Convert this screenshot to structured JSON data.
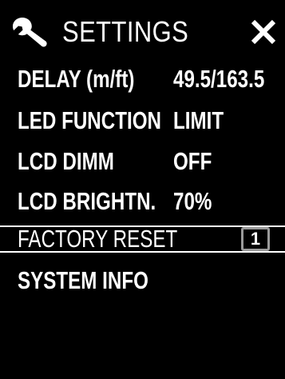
{
  "header": {
    "title": "SETTINGS",
    "left_icon": "wrench-icon",
    "right_icon": "close-icon"
  },
  "menu": {
    "items": [
      {
        "label": "DELAY (m/ft)",
        "value": "49.5/163.5"
      },
      {
        "label": "LED FUNCTION",
        "value": "LIMIT"
      },
      {
        "label": "LCD DIMM",
        "value": "OFF"
      },
      {
        "label": "LCD BRIGHTN.",
        "value": "70%"
      },
      {
        "label": "FACTORY RESET",
        "value": "",
        "badge": "1",
        "selected": true
      },
      {
        "label": "SYSTEM INFO",
        "value": ""
      }
    ]
  },
  "colors": {
    "background": "#000000",
    "foreground": "#ffffff",
    "badge_border": "#9a9a9a"
  }
}
